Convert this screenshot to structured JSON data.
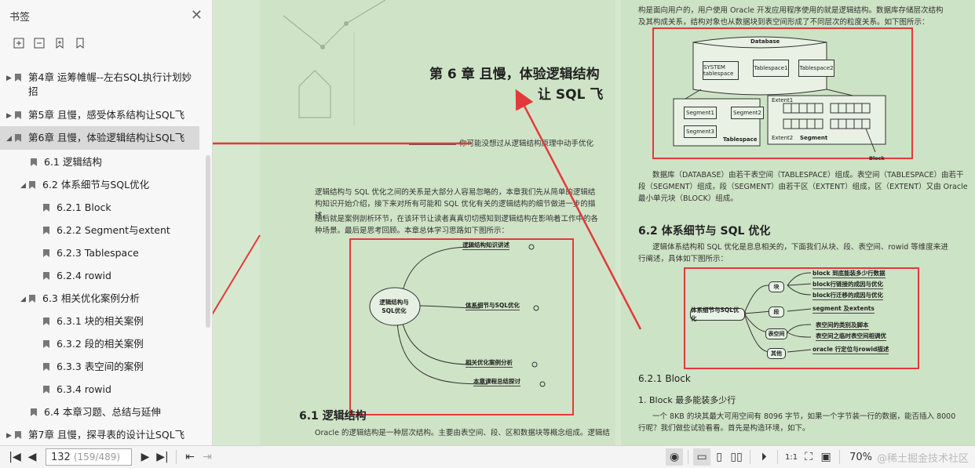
{
  "sidebar": {
    "title": "书签",
    "close_icon": "close-icon",
    "tools": [
      "expand-bookmark-icon",
      "collapse-bookmark-icon",
      "add-bookmark-icon",
      "bookmark-icon"
    ],
    "items": [
      {
        "label": "第4章 运筹帷幄--左右SQL执行计划妙招",
        "level": 0,
        "expanded": false
      },
      {
        "label": "第5章 且慢，感受体系结构让SQL飞",
        "level": 0,
        "expanded": false
      },
      {
        "label": "第6章 且慢，体验逻辑结构让SQL飞",
        "level": 0,
        "expanded": true,
        "selected": true
      },
      {
        "label": "6.1 逻辑结构",
        "level": 1
      },
      {
        "label": "6.2 体系细节与SQL优化",
        "level": 1,
        "expanded": true
      },
      {
        "label": "6.2.1 Block",
        "level": 2
      },
      {
        "label": "6.2.2 Segment与extent",
        "level": 2
      },
      {
        "label": "6.2.3 Tablespace",
        "level": 2
      },
      {
        "label": "6.2.4 rowid",
        "level": 2
      },
      {
        "label": "6.3 相关优化案例分析",
        "level": 1,
        "expanded": true
      },
      {
        "label": "6.3.1 块的相关案例",
        "level": 2
      },
      {
        "label": "6.3.2 段的相关案例",
        "level": 2
      },
      {
        "label": "6.3.3 表空间的案例",
        "level": 2
      },
      {
        "label": "6.3.4 rowid",
        "level": 2
      },
      {
        "label": "6.4 本章习题、总结与延伸",
        "level": 1
      },
      {
        "label": "第7章 且慢，探寻表的设计让SQL飞",
        "level": 0,
        "expanded": false
      }
    ]
  },
  "left_page": {
    "chapter_title_1": "第 6 章  且慢，体验逻辑结构",
    "chapter_title_2": "让 SQL 飞",
    "epigraph": "你可能没想过从逻辑结构原理中动手优化",
    "para1": "逻辑结构与 SQL 优化之间的关系是大部分人容易忽略的，本章我们先从简单的逻辑结构知识开始介绍，接下来对所有可能和 SQL 优化有关的逻辑结构的细节做进一步的描述。",
    "para2": "随后就是案例剖析环节，在该环节让读者真真切切感知到逻辑结构在影响着工作中的各种场景。最后是思考回顾。本章总体学习思路如下图所示：",
    "mindmap_center": "逻辑结构与SQL优化",
    "mindmap_nodes": [
      "逻辑结构知识讲述",
      "体系细节与SQL优化",
      "相关优化案例分析",
      "本章课程总结探讨"
    ],
    "section_title": "6.1   逻辑结构",
    "section_text": "Oracle 的逻辑结构是一种层次结构。主要由表空间、段、区和数据块等概念组成。逻辑结"
  },
  "right_page": {
    "top_text_1": "构是面向用户的，用户使用 Oracle 开发应用程序使用的就是逻辑结构。数据库存储层次结构",
    "top_text_2": "及其构成关系，结构对象也从数据块到表空间形成了不同层次的粒度关系。如下图所示：",
    "diagram": {
      "database": "Database",
      "system_ts": "SYSTEM tablespace",
      "ts1": "Tablespace1",
      "ts2": "Tablespace2",
      "segment1": "Segment1",
      "segment2": "Segment2",
      "segment3": "Segment3",
      "tablespace": "Tablespace",
      "extent1": "Extent1",
      "extent2": "Extent2",
      "segment": "Segment",
      "block": "Block"
    },
    "desc_text_1": "数据库（DATABASE）由若干表空间（TABLESPACE）组成。表空间（TABLESPACE）由若干",
    "desc_text_2": "段（SEGMENT）组成，段（SEGMENT）由若干区（EXTENT）组成，区（EXTENT）又由 Oracle 的",
    "desc_text_3": "最小单元块（BLOCK）组成。",
    "h2": "6.2   体系细节与 SQL 优化",
    "h2_text_1": "逻辑体系结构和 SQL 优化是息息相关的，下面我们从块、段、表空间、rowid 等维度来进",
    "h2_text_2": "行阐述，具体如下图所示：",
    "mindmap": {
      "center": "体系细节与SQL优化",
      "branches": [
        "块",
        "段",
        "表空间",
        "其他"
      ],
      "leaves": [
        "block 到底能装多少行数据",
        "block行链接的成因与优化",
        "block行迁移的成因与优化",
        "segment 及extents",
        "表空间的类别及脚本",
        "表空间之临时表空间相调优",
        "oracle 行定位与rowid描述"
      ]
    },
    "h3": "6.2.1   Block",
    "h4": "1. Block 最多能装多少行",
    "body_1": "一个 8KB 的块其最大可用空间有 8096 字节，如果一个字节装一行的数据，能否插入 8000",
    "body_2": "行呢？我们做些试验看看。首先是构造环境，如下。"
  },
  "bottom": {
    "page_current": "132",
    "page_total": "(159/489)",
    "zoom": "70%",
    "watermark": "@稀土掘金技术社区"
  },
  "colors": {
    "annotation_red": "#e23a3a",
    "page_green": "#cfe4c7",
    "selected_gray": "#d9d9d9"
  }
}
